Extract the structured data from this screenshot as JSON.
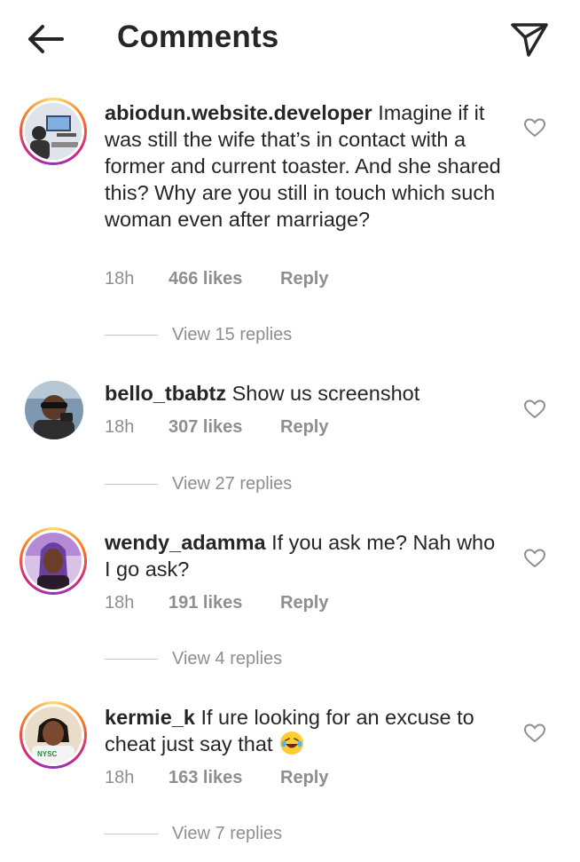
{
  "header": {
    "title": "Comments",
    "back_icon": "arrow-left-icon",
    "send_icon": "paper-plane-icon"
  },
  "comments": [
    {
      "username": "abiodun.website.developer",
      "text": "Imagine if it was still the wife that’s in contact with a former and current toaster. And she shared this? Why are you still in touch which such woman even after marriage?",
      "time": "18h",
      "likes": "466 likes",
      "reply": "Reply",
      "view_replies": "View 15 replies",
      "avatar_ring": true
    },
    {
      "username": "bello_tbabtz",
      "text": "Show us screenshot",
      "time": "18h",
      "likes": "307 likes",
      "reply": "Reply",
      "view_replies": "View 27 replies",
      "avatar_ring": false
    },
    {
      "username": "wendy_adamma",
      "text": "If you ask me? Nah who I go ask?",
      "time": "18h",
      "likes": "191 likes",
      "reply": "Reply",
      "view_replies": "View 4 replies",
      "avatar_ring": true
    },
    {
      "username": "kermie_k",
      "text": "If ure looking for an excuse to cheat just say that",
      "emoji": "😂",
      "avatar_text": "NYSC",
      "time": "18h",
      "likes": "163 likes",
      "reply": "Reply",
      "view_replies": "View 7 replies",
      "avatar_ring": true
    }
  ],
  "colors": {
    "text": "#262626",
    "muted": "#8e8e8e",
    "divider": "#c7c7c7"
  }
}
